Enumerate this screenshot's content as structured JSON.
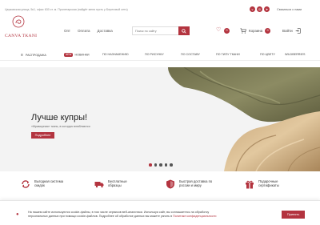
{
  "header": {
    "address": "Церковская улица, 5к1, офис 630 ст. м. Пролетарская (найдёт меня пусть у Береговой сеть)",
    "contact_link": "Связаться с нами",
    "logo_text": "CANVA TKANI",
    "top_nav": [
      "Опт",
      "Оплата",
      "Доставка"
    ],
    "search_placeholder": "Поиск по сайту",
    "favorites_count": "0",
    "cart_label": "Корзина",
    "cart_count": "0",
    "login_label": "Войти"
  },
  "categories": {
    "sale": "Распродажа",
    "new_badge": "NEW",
    "new": "Новинки",
    "items": [
      "По назначению",
      "По рисунку",
      "По составу",
      "По типу ткани",
      "По цвету",
      "Wildberries"
    ]
  },
  "hero": {
    "title": "Лучше купры!",
    "subtitle": "«Мраморная» ткань, в которую влюбляются",
    "button": "Подробнее"
  },
  "features": [
    {
      "icon": "refresh-icon",
      "line1": "Выгодная система",
      "line2": "скидок"
    },
    {
      "icon": "truck-icon",
      "line1": "Бесплатные",
      "line2": "образцы"
    },
    {
      "icon": "shield-icon",
      "line1": "Быстрая доставка по",
      "line2": "россии и миру"
    },
    {
      "icon": "gift-icon",
      "line1": "Подарочные",
      "line2": "сертификаты"
    }
  ],
  "cookie": {
    "line1": "На нашем сайте используются cookie-файлы, в том числе сервисов веб-аналитики. Используя сайт, вы соглашаетесь на обработку",
    "line2": "персональных данных при помощи cookie-файлов. Подробнее об обработке данных вы можете узнать в",
    "link": "Политике конфиденциальности",
    "button": "Принять"
  },
  "colors": {
    "accent": "#b3343f",
    "hero_bg": "#f3f3f3"
  }
}
